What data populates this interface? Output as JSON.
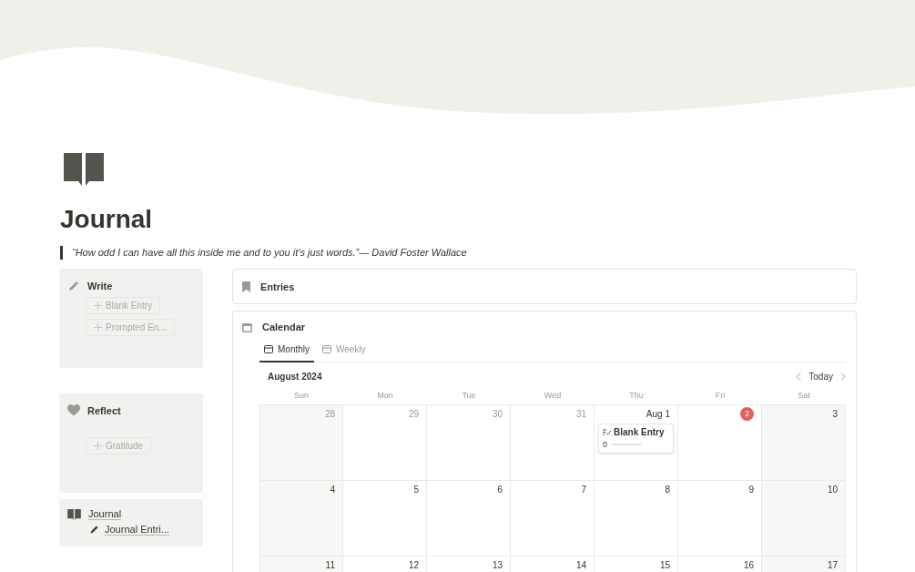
{
  "page": {
    "title": "Journal",
    "quote": "“How odd I can have all this inside me and to you it’s just words.”— David Foster Wallace"
  },
  "sidebar": [
    {
      "kind": "buttons",
      "title": "Write",
      "buttons": [
        "Blank Entry",
        "Prompted En..."
      ]
    },
    {
      "kind": "buttons",
      "title": "Reflect",
      "buttons": [
        "Gratitude"
      ]
    },
    {
      "kind": "links",
      "title": "Journal",
      "links": [
        "Journal Entri..."
      ]
    }
  ],
  "entries": {
    "title": "Entries"
  },
  "calendar": {
    "title": "Calendar",
    "tabs": [
      {
        "label": "Monthly",
        "selected": true
      },
      {
        "label": "Weekly",
        "selected": false
      }
    ],
    "month": "August 2024",
    "today_button": "Today",
    "weekdays": [
      "Sun",
      "Mon",
      "Tue",
      "Wed",
      "Thu",
      "Fri",
      "Sat"
    ],
    "weeks": [
      [
        {
          "label": "28",
          "in_month": false,
          "today": false
        },
        {
          "label": "29",
          "in_month": false,
          "today": false
        },
        {
          "label": "30",
          "in_month": false,
          "today": false
        },
        {
          "label": "31",
          "in_month": false,
          "today": false
        },
        {
          "label": "Aug 1",
          "in_month": true,
          "today": false,
          "events": [
            {
              "title": "Blank Entry",
              "count": "0",
              "level": 0
            }
          ]
        },
        {
          "label": "2",
          "in_month": true,
          "today": true
        },
        {
          "label": "3",
          "in_month": true,
          "today": false
        }
      ],
      [
        {
          "label": "4",
          "in_month": true,
          "today": false
        },
        {
          "label": "5",
          "in_month": true,
          "today": false
        },
        {
          "label": "6",
          "in_month": true,
          "today": false
        },
        {
          "label": "7",
          "in_month": true,
          "today": false
        },
        {
          "label": "8",
          "in_month": true,
          "today": false
        },
        {
          "label": "9",
          "in_month": true,
          "today": false
        },
        {
          "label": "10",
          "in_month": true,
          "today": false
        }
      ],
      [
        {
          "label": "11",
          "in_month": true,
          "today": false
        },
        {
          "label": "12",
          "in_month": true,
          "today": false
        },
        {
          "label": "13",
          "in_month": true,
          "today": false
        },
        {
          "label": "14",
          "in_month": true,
          "today": false
        },
        {
          "label": "15",
          "in_month": true,
          "today": false
        },
        {
          "label": "16",
          "in_month": true,
          "today": false
        },
        {
          "label": "17",
          "in_month": true,
          "today": false
        }
      ]
    ]
  }
}
